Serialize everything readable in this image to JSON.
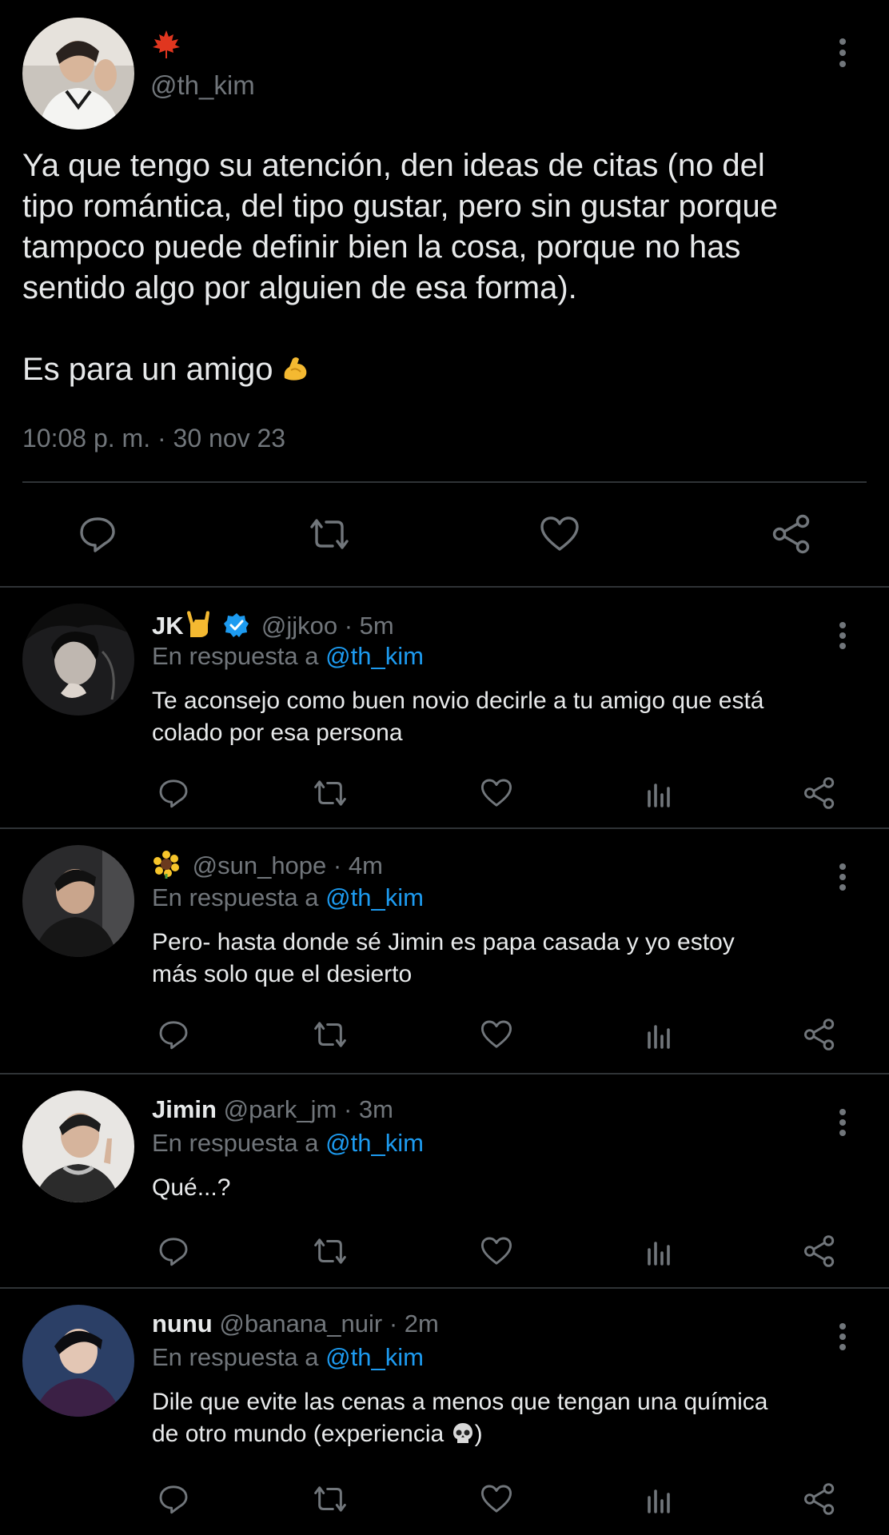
{
  "main": {
    "handle": "@th_kim",
    "text_line1": "Ya que tengo su atención, den ideas de citas (no del",
    "text_line2": "tipo romántica, del tipo gustar, pero sin gustar porque",
    "text_line3": "tampoco puede definir bien la cosa, porque no has",
    "text_line4": "sentido algo por alguien de esa forma).",
    "text_line5": "Es para un amigo",
    "timestamp": "10:08 p. m. · 30 nov 23"
  },
  "replies": [
    {
      "name": "JK",
      "handle": "@jjkoo",
      "time": "· 5m",
      "in_reply_prefix": "En respuesta a ",
      "in_reply_handle": "@th_kim",
      "text_line1": "Te aconsejo como buen novio decirle a tu amigo que está",
      "text_line2": "colado por esa persona"
    },
    {
      "name": "",
      "handle": "@sun_hope",
      "time": "· 4m",
      "in_reply_prefix": "En respuesta a ",
      "in_reply_handle": "@th_kim",
      "text_line1": "Pero- hasta donde sé Jimin es papa casada y yo estoy",
      "text_line2": "más solo que el desierto"
    },
    {
      "name": "Jimin",
      "handle": "@park_jm",
      "time": "· 3m",
      "in_reply_prefix": "En respuesta a ",
      "in_reply_handle": "@th_kim",
      "text_line1": "Qué...?",
      "text_line2": ""
    },
    {
      "name": "nunu",
      "handle": "@banana_nuir",
      "time": "· 2m",
      "in_reply_prefix": "En respuesta a ",
      "in_reply_handle": "@th_kim",
      "text_line1": "Dile que evite las cenas a menos que tengan una química",
      "text_line2": "de otro mundo (experiencia"
    }
  ],
  "colors": {
    "background": "#000000",
    "text": "#e7e9ea",
    "muted": "#71767b",
    "link": "#1d9bf0",
    "divider": "#2f3336",
    "verified": "#1d9bf0"
  },
  "icons": [
    "maple-leaf-icon",
    "more-options-icon",
    "reply-icon",
    "retweet-icon",
    "like-icon",
    "share-icon",
    "views-icon",
    "verified-badge-icon",
    "flexed-biceps-icon",
    "sign-of-horns-icon",
    "sunflower-icon",
    "skull-icon"
  ]
}
